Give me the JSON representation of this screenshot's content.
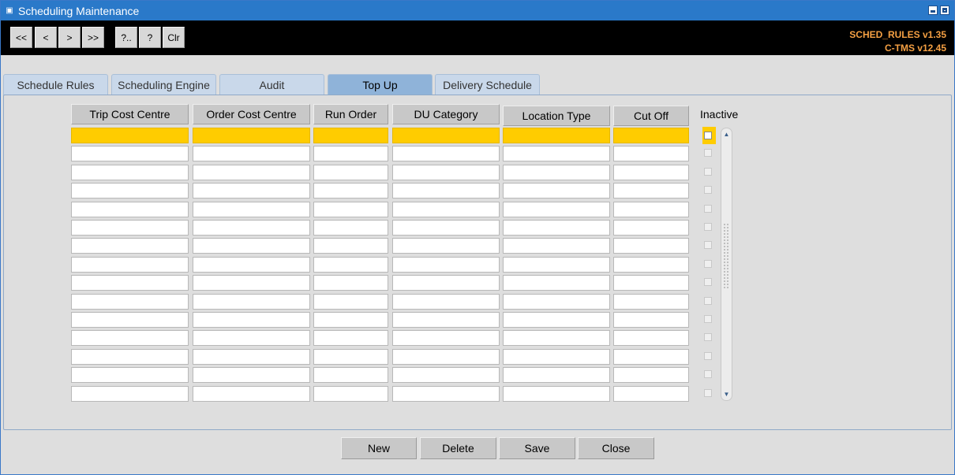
{
  "window": {
    "title": "Scheduling Maintenance",
    "icon": "form-icon"
  },
  "toolbar": {
    "buttons": [
      "<<",
      "<",
      ">",
      ">>",
      "?..",
      "?",
      "Clr"
    ],
    "version_line1": "SCHED_RULES v1.35",
    "version_line2": "C-TMS v12.45"
  },
  "tabs": [
    "Schedule Rules",
    "Scheduling Engine",
    "Audit",
    "Top Up",
    "Delivery Schedule"
  ],
  "active_tab": "Top Up",
  "grid": {
    "columns": [
      "Trip Cost Centre",
      "Order Cost Centre",
      "Run Order",
      "DU Category",
      "Location Type",
      "Cut Off"
    ],
    "inactive_label": "Inactive",
    "row_count": 15,
    "selected_row": 0
  },
  "actions": {
    "new": "New",
    "delete": "Delete",
    "save": "Save",
    "close": "Close"
  },
  "colors": {
    "titlebar": "#2a79c9",
    "accent_selected": "#ffcc00",
    "version_text": "#f5a043",
    "active_tab": "#8fb3d9"
  }
}
